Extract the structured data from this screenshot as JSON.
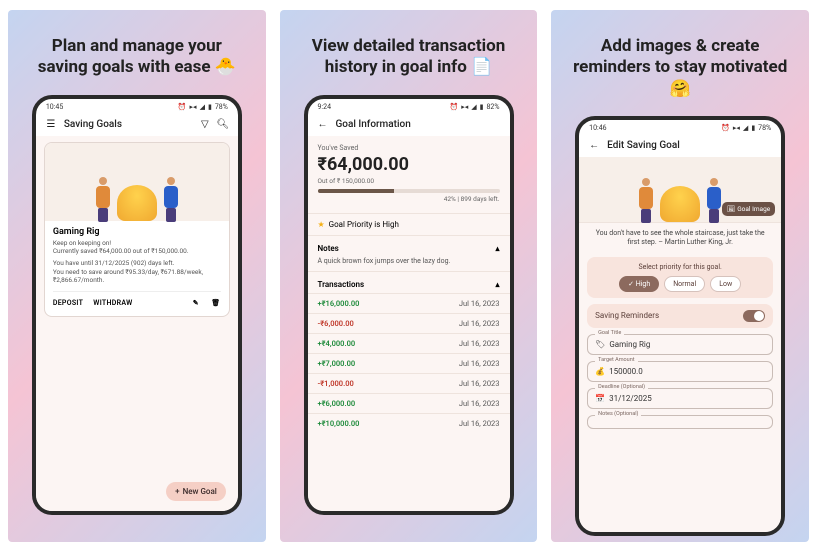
{
  "panels": [
    {
      "headline": "Plan and manage your saving goals with ease 🐣"
    },
    {
      "headline": "View detailed transaction history in goal info 📄"
    },
    {
      "headline": "Add images & create reminders to stay motivated 🤗"
    }
  ],
  "screen1": {
    "status_time": "10:45",
    "status_battery": "78%",
    "app_title": "Saving Goals",
    "card": {
      "title": "Gaming Rig",
      "keep": "Keep on keeping on!",
      "saved": "Currently saved ₹64,000.00 out of ₹150,000.00.",
      "time_left": "You have until 31/12/2025 (902) days left.",
      "need": "You need to save around ₹95.33/day, ₹671.88/week, ₹2,866.67/month.",
      "deposit": "DEPOSIT",
      "withdraw": "WITHDRAW"
    },
    "fab": "New Goal"
  },
  "screen2": {
    "status_time": "9:24",
    "status_battery": "82%",
    "app_title": "Goal Information",
    "saved_label": "You've Saved",
    "amount": "₹64,000.00",
    "out_of": "Out of ₹ 150,000.00",
    "progress_pct": 42,
    "progress_meta": "42% | 899 days left.",
    "priority": "Goal Priority is High",
    "notes_label": "Notes",
    "notes_text": "A quick brown fox jumps over the lazy dog.",
    "txn_label": "Transactions",
    "transactions": [
      {
        "amount": "+₹16,000.00",
        "sign": "pos",
        "date": "Jul 16, 2023"
      },
      {
        "amount": "-₹6,000.00",
        "sign": "neg",
        "date": "Jul 16, 2023"
      },
      {
        "amount": "+₹4,000.00",
        "sign": "pos",
        "date": "Jul 16, 2023"
      },
      {
        "amount": "+₹7,000.00",
        "sign": "pos",
        "date": "Jul 16, 2023"
      },
      {
        "amount": "-₹1,000.00",
        "sign": "neg",
        "date": "Jul 16, 2023"
      },
      {
        "amount": "+₹6,000.00",
        "sign": "pos",
        "date": "Jul 16, 2023"
      },
      {
        "amount": "+₹10,000.00",
        "sign": "pos",
        "date": "Jul 16, 2023"
      }
    ]
  },
  "screen3": {
    "status_time": "10:46",
    "status_battery": "78%",
    "app_title": "Edit Saving Goal",
    "goal_image_btn": "Goal Image",
    "quote": "You don't have to see the whole staircase, just take the first step. – Martin Luther King, Jr.",
    "priority_label": "Select priority for this goal.",
    "priority_high": "High",
    "priority_normal": "Normal",
    "priority_low": "Low",
    "reminders": "Saving Reminders",
    "fields": {
      "title_label": "Goal Title",
      "title_value": "Gaming Rig",
      "target_label": "Target Amount",
      "target_value": "150000.0",
      "deadline_label": "Deadline (Optional)",
      "deadline_value": "31/12/2025",
      "notes_label": "Notes (Optional)"
    }
  }
}
